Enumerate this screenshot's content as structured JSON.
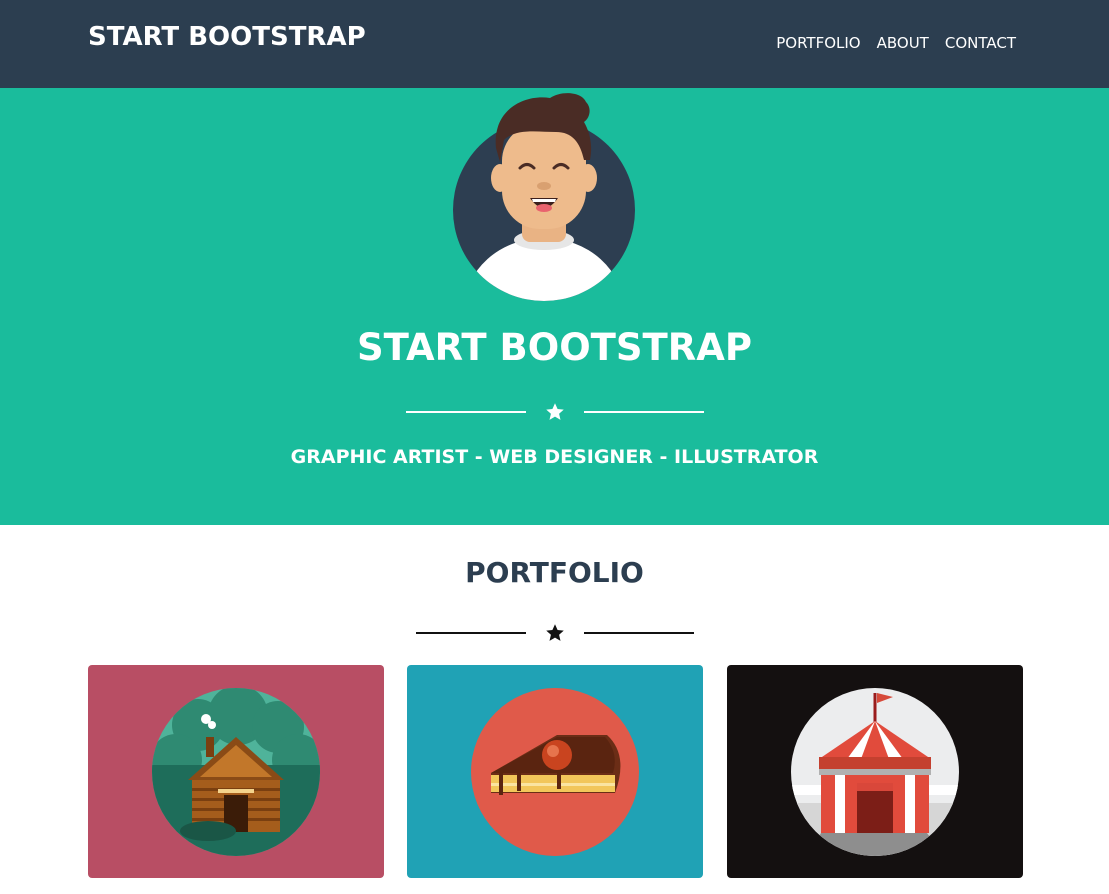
{
  "navbar": {
    "brand": "START BOOTSTRAP",
    "links": [
      "PORTFOLIO",
      "ABOUT",
      "CONTACT"
    ]
  },
  "masthead": {
    "heading": "START BOOTSTRAP",
    "subheading": "GRAPHIC ARTIST - WEB DESIGNER - ILLUSTRATOR",
    "divider_icon": "star-icon"
  },
  "portfolio": {
    "title": "PORTFOLIO",
    "divider_icon": "star-icon",
    "items": [
      {
        "icon": "cabin-icon",
        "bg": "#b84e64"
      },
      {
        "icon": "cake-icon",
        "bg": "#20a2b5"
      },
      {
        "icon": "circus-tent-icon",
        "bg": "#141010"
      }
    ]
  },
  "colors": {
    "navbar": "#2c3e50",
    "masthead": "#1abc9c",
    "white": "#ffffff"
  }
}
